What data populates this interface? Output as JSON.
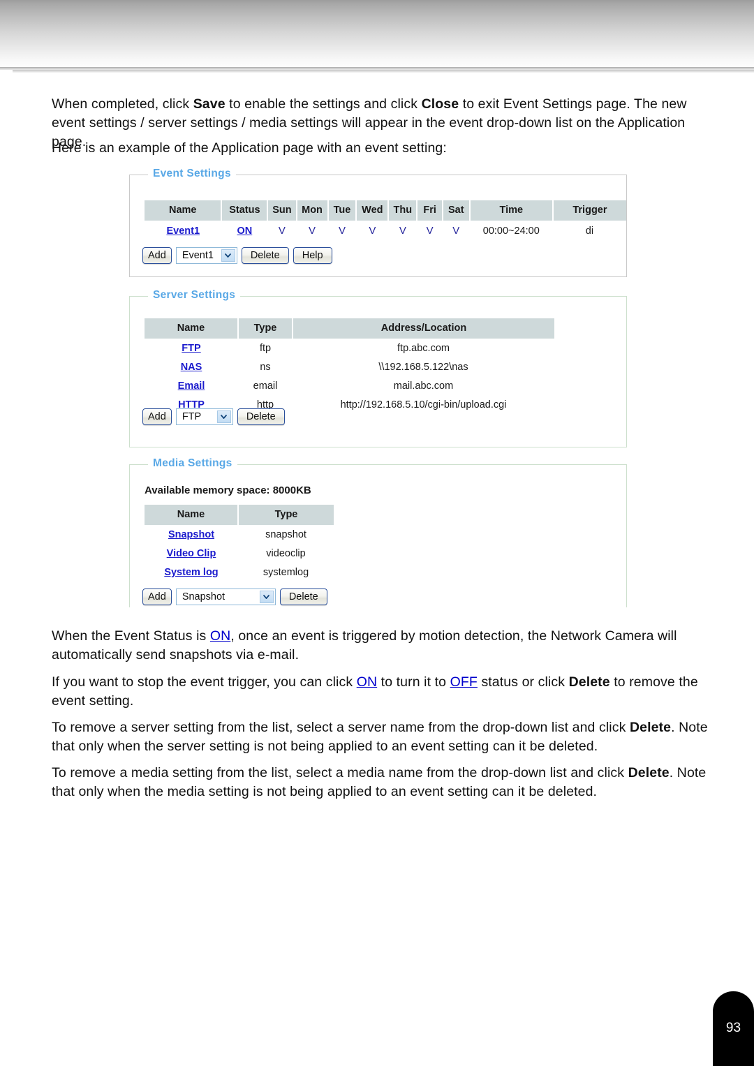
{
  "document": {
    "page_number": "93"
  },
  "paragraphs": {
    "p1_part1": "When completed, click ",
    "p1_bold1": "Save",
    "p1_part2": " to enable the settings and click ",
    "p1_bold2": "Close",
    "p1_part3": " to exit Event Settings page. The new event settings / server settings / media settings will appear in the event drop-down list on the Application page.",
    "p2": "Here is an example of the Application page with an event setting:",
    "p3_part1": "When the Event Status is ",
    "p3_link1": "ON",
    "p3_part2": ", once an event is triggered by motion detection, the Network Camera will automatically send snapshots via e-mail.",
    "p4_part1": "If you want to stop the event trigger, you can click ",
    "p4_link1": "ON",
    "p4_part2": " to turn it to ",
    "p4_link2": "OFF",
    "p4_part3": " status or click ",
    "p4_bold1": "Delete",
    "p4_part4": " to remove the event setting.",
    "p5_part1": "To remove a server setting from the list, select a server name from the drop-down list and click ",
    "p5_bold1": "Delete",
    "p5_part2": ". Note that only when the server setting is not being applied to an event setting can it be deleted.",
    "p6_part1": "To remove a media setting from the list, select a media name from the drop-down list and click ",
    "p6_bold1": "Delete",
    "p6_part2": ". Note that only when the media setting is not being applied to an event setting can it be deleted."
  },
  "event_settings": {
    "legend": "Event Settings",
    "columns": [
      "Name",
      "Status",
      "Sun",
      "Mon",
      "Tue",
      "Wed",
      "Thu",
      "Fri",
      "Sat",
      "Time",
      "Trigger"
    ],
    "rows": [
      {
        "name": "Event1",
        "status": "ON",
        "sun": "V",
        "mon": "V",
        "tue": "V",
        "wed": "V",
        "thu": "V",
        "fri": "V",
        "sat": "V",
        "time": "00:00~24:00",
        "trigger": "di"
      }
    ],
    "controls": {
      "add_label": "Add",
      "select_value": "Event1",
      "delete_label": "Delete",
      "help_label": "Help"
    }
  },
  "server_settings": {
    "legend": "Server Settings",
    "columns": [
      "Name",
      "Type",
      "Address/Location"
    ],
    "rows": [
      {
        "name": "FTP",
        "type": "ftp",
        "address": "ftp.abc.com"
      },
      {
        "name": "NAS",
        "type": "ns",
        "address": "\\\\192.168.5.122\\nas"
      },
      {
        "name": "Email",
        "type": "email",
        "address": "mail.abc.com"
      },
      {
        "name": "HTTP",
        "type": "http",
        "address": "http://192.168.5.10/cgi-bin/upload.cgi"
      }
    ],
    "controls": {
      "add_label": "Add",
      "select_value": "FTP",
      "delete_label": "Delete"
    }
  },
  "media_settings": {
    "legend": "Media Settings",
    "memory_line": "Available memory space: 8000KB",
    "columns": [
      "Name",
      "Type"
    ],
    "rows": [
      {
        "name": "Snapshot",
        "type": "snapshot"
      },
      {
        "name": "Video Clip",
        "type": "videoclip"
      },
      {
        "name": "System log",
        "type": "systemlog"
      }
    ],
    "controls": {
      "add_label": "Add",
      "select_value": "Snapshot",
      "delete_label": "Delete"
    }
  },
  "colors": {
    "legend_blue": "#59a8e6",
    "table_header_bg": "#ced9da",
    "link_blue": "#1a1acd",
    "button_border": "#2a4f9b",
    "page_tab_bg": "#000000"
  }
}
